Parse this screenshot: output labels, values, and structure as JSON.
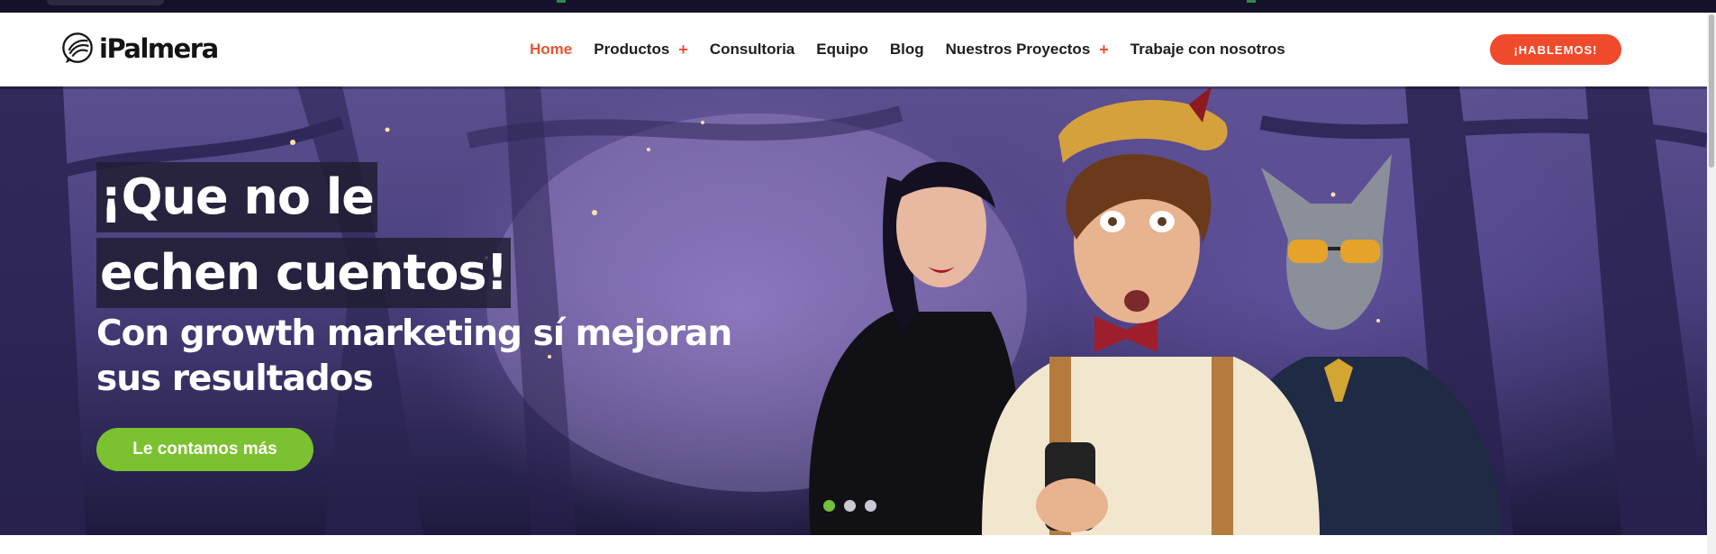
{
  "site": {
    "logo_text": "iPalmera"
  },
  "nav": {
    "items": [
      {
        "label": "Home",
        "active": true,
        "has_submenu": false
      },
      {
        "label": "Productos",
        "active": false,
        "has_submenu": true
      },
      {
        "label": "Consultoria",
        "active": false,
        "has_submenu": false
      },
      {
        "label": "Equipo",
        "active": false,
        "has_submenu": false
      },
      {
        "label": "Blog",
        "active": false,
        "has_submenu": false
      },
      {
        "label": "Nuestros Proyectos",
        "active": false,
        "has_submenu": true
      },
      {
        "label": "Trabaje con nosotros",
        "active": false,
        "has_submenu": false
      }
    ],
    "submenu_icon": "+",
    "cta_label": "¡HABLEMOS!"
  },
  "hero": {
    "headline_line1": "¡Que no le",
    "headline_line2": "echen cuentos!",
    "subheadline": "Con growth marketing sí mejoran sus resultados",
    "cta_label": "Le contamos más",
    "slider": {
      "total_slides": 3,
      "active_slide": 1
    }
  },
  "colors": {
    "accent_orange": "#f04a2c",
    "nav_active": "#e8552f",
    "hero_cta_green": "#7cc130",
    "slider_dot_active": "#6fc23a",
    "hero_background": "#4a3f7e"
  }
}
